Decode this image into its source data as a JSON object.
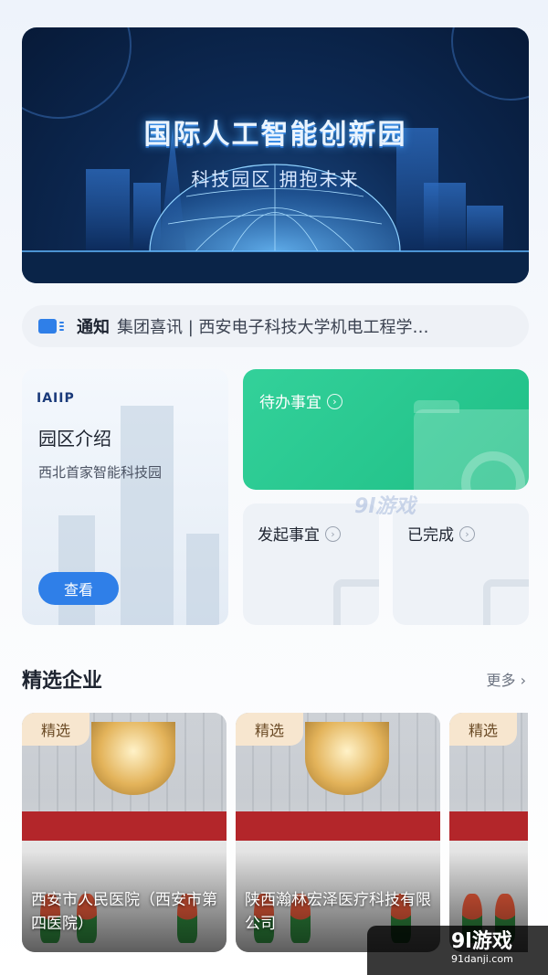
{
  "banner": {
    "title": "国际人工智能创新园",
    "subtitle": "科技园区  拥抱未来"
  },
  "notice": {
    "label": "通知",
    "text": "集团喜讯 | 西安电子科技大学机电工程学…"
  },
  "park_card": {
    "logo": "IAIIP",
    "title": "园区介绍",
    "description": "西北首家智能科技园",
    "button": "查看"
  },
  "tasks": {
    "todo": "待办事宜",
    "initiate": "发起事宜",
    "done": "已完成"
  },
  "featured": {
    "title": "精选企业",
    "more": "更多 ›",
    "items": [
      {
        "tag": "精选",
        "name": "西安市人民医院（西安市第四医院）"
      },
      {
        "tag": "精选",
        "name": "陕西瀚林宏泽医疗科技有限公司"
      },
      {
        "tag": "精选",
        "name": ""
      }
    ]
  },
  "watermark": {
    "center": "9l游戏",
    "corner_logo": "9l游戏",
    "corner_url": "91danji.com"
  },
  "colors": {
    "primary": "#2f7fe8",
    "todo_green": "#22c38b",
    "tag_bg": "#f7e6cf"
  }
}
